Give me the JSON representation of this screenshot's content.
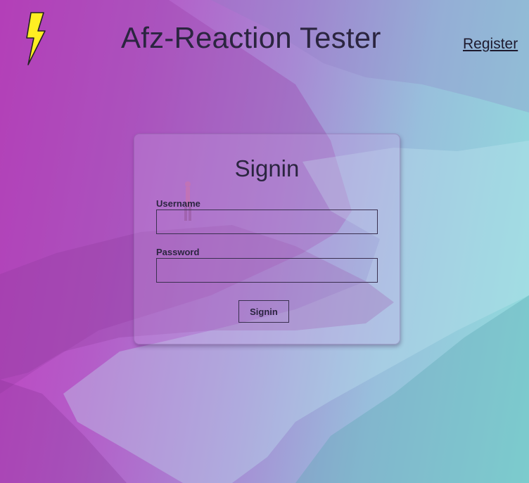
{
  "header": {
    "title": "Afz-Reaction Tester",
    "register_label": "Register",
    "logo_icon": "lightning-bolt-icon"
  },
  "signin_form": {
    "title": "Signin",
    "username_label": "Username",
    "username_value": "",
    "password_label": "Password",
    "password_value": "",
    "submit_label": "Signin"
  },
  "colors": {
    "gradient_left": "#c13fc0",
    "gradient_right": "#8fe0dc",
    "bolt_fill": "#ffee22",
    "text": "#2b2540"
  }
}
